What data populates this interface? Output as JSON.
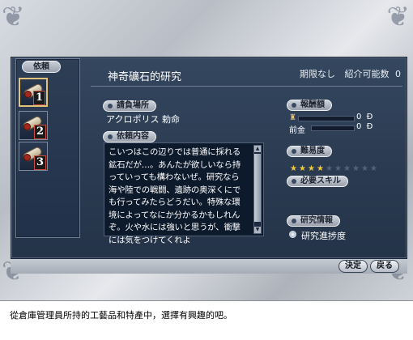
{
  "side_header": "依頼",
  "requests": [
    {
      "number": "1",
      "icon": "scroll-icon",
      "selected": true
    },
    {
      "number": "2",
      "icon": "scroll-icon",
      "selected": false
    },
    {
      "number": "3",
      "icon": "scroll-icon",
      "selected": false
    }
  ],
  "quest": {
    "title": "神奇礦石的研究",
    "deadline": "期限なし",
    "intro_label": "紹介可能数",
    "intro_count": "0"
  },
  "client": {
    "label": "請負場所",
    "value": "アクロポリス 勅命"
  },
  "details": {
    "label": "依頼内容",
    "text": "こいつはこの辺りでは普通に採れる\n鉱石だが…。あんたが欲しいなら持\nっていっても構わないぜ。研究なら\n海や陸での戦闘、遺跡の奥深くにで\nも行ってみたらどうだい。特殊な環\n境によってなにか分かるかもしれん\nぞ。火や水には強いと思うが、衝撃\nには気をつけてくれよ"
  },
  "reward": {
    "label": "報酬額",
    "reward_value": "0",
    "advance_label": "前金",
    "advance_value": "0",
    "currency": "Ð"
  },
  "difficulty": {
    "label": "難易度",
    "stars_on": 4,
    "stars_total": 10
  },
  "skills": {
    "label": "必要スキル"
  },
  "research": {
    "label": "研究情報",
    "item_label": "研究進捗度"
  },
  "buttons": {
    "confirm": "決定",
    "back": "戻る"
  },
  "caption": "從倉庫管理員所持的工藝品和特產中，選擇有興趣的吧。",
  "colors": {
    "panel": "#2a3a50",
    "star_on": "#f0c83a",
    "highlight": "#e2c27a"
  }
}
